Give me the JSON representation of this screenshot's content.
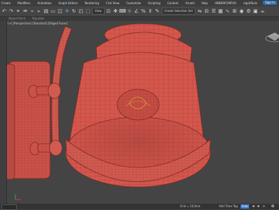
{
  "menubar": {
    "items": [
      "Create",
      "Modifiers",
      "Animation",
      "Graph Editors",
      "Rendering",
      "Civil View",
      "Customize",
      "Scripting",
      "Content",
      "Arnold",
      "Help",
      "UNDERFONTOS",
      "rapidTools"
    ],
    "user_button": "Sign In"
  },
  "toolbar": {
    "view_dropdown": "View",
    "selection_set": "Create Selection Set"
  },
  "ribbon": {
    "items": [
      "Object Paint",
      "Populate"
    ]
  },
  "viewport": {
    "label": "[+] [Perspective] [Standard] [Edged Faces]"
  },
  "statusbar": {
    "coordinate_readout": "0/0",
    "grid_readout": "Grid = 10,0cm",
    "add_time_tag": "Add Time Tag",
    "auto_key": "Auto"
  },
  "colors": {
    "mesh_fill": "#d4574d",
    "wire": "#8a2e28",
    "background": "#444444",
    "accent": "#3d7bd0"
  }
}
